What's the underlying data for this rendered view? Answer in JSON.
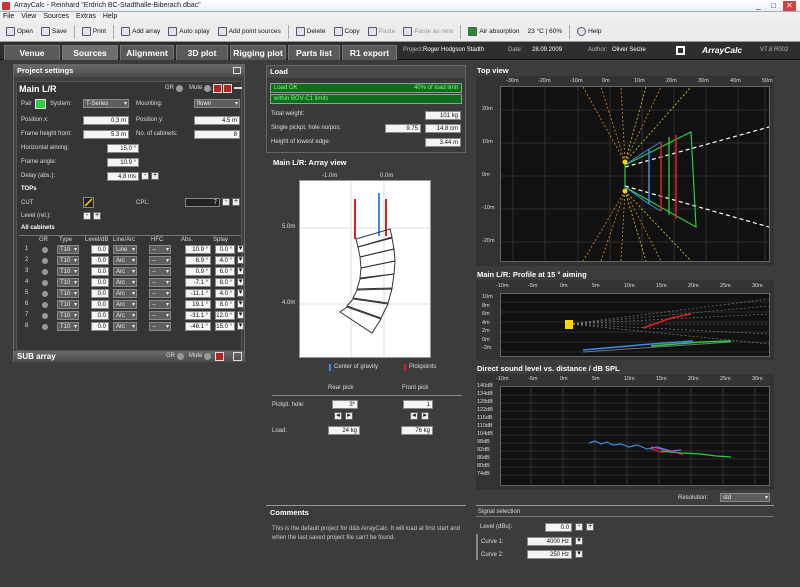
{
  "window": {
    "title": "ArrayCalc - Reinhard \"Erdrich BC-Stadthalle-Biberach.dbac\"",
    "controls": [
      "_",
      "□",
      "✕"
    ]
  },
  "menu": [
    "File",
    "View",
    "Sources",
    "Extras",
    "Help"
  ],
  "toolbar": [
    {
      "label": "Open",
      "enabled": true
    },
    {
      "label": "Save",
      "enabled": true
    },
    {
      "label": "Print",
      "enabled": true
    },
    {
      "label": "Add array",
      "enabled": true
    },
    {
      "label": "Auto splay",
      "enabled": true
    },
    {
      "label": "Add point sources",
      "enabled": true
    },
    {
      "label": "Delete",
      "enabled": true
    },
    {
      "label": "Copy",
      "enabled": true
    },
    {
      "label": "Paste",
      "enabled": false
    },
    {
      "label": "Paste as new",
      "enabled": false
    },
    {
      "label": "Air absorption",
      "enabled": true
    },
    {
      "label": "23 °C | 60%",
      "enabled": true
    },
    {
      "label": "Help",
      "enabled": true
    }
  ],
  "tabs": [
    "Venue",
    "Sources",
    "Alignment",
    "3D plot",
    "Rigging plot",
    "Parts list",
    "R1 export"
  ],
  "active_tab": "Sources",
  "project": {
    "project_label": "Project:",
    "project": "Roger Hodgson Stadth",
    "date_label": "Date:",
    "date": "28.09.2009",
    "author_label": "Author:",
    "author": "Oliver Seizie",
    "brand": "ArrayCalc",
    "version": "V7.8 R002"
  },
  "settings": {
    "title": "Project settings",
    "main_title": "Main L/R",
    "gr": "GR",
    "mute": "Mute",
    "pair_label": "Pair",
    "system_label": "System:",
    "system": "T-Series",
    "mounting_label": "Mounting:",
    "mounting": "flown",
    "position_x_label": "Position x:",
    "position_x": "0.3 m",
    "position_y_label": "Position y:",
    "position_y": "4.5 m",
    "frame_height_label": "Frame height front:",
    "frame_height": "5.3 m",
    "cabinets_label": "No. of cabinets:",
    "cabinets": "8",
    "aiming_label": "Horizontal aiming:",
    "aiming": "15.0 °",
    "frame_angle_label": "Frame angle:",
    "frame_angle": "10.9 °",
    "delay_label": "Delay (abs.):",
    "delay": "4.8 ms",
    "tops_label": "TOPs",
    "cut_label": "CUT",
    "cpl_label": "CPL:",
    "cpl": "7",
    "level_label": "Level (rel.):",
    "all_cabinets": "All cabinets",
    "columns": [
      "GR",
      "Type",
      "Level/dB",
      "Line/Arc",
      "HFC",
      "Abs.",
      "Splay"
    ],
    "rows": [
      {
        "n": "1",
        "type": "T10",
        "level": "0.0",
        "la": "Line",
        "hfc": "--",
        "abs": "10.9 °",
        "splay": "0.0 °"
      },
      {
        "n": "2",
        "type": "T10",
        "level": "0.0",
        "la": "Arc",
        "hfc": "--",
        "abs": "6.9 °",
        "splay": "4.0 °"
      },
      {
        "n": "3",
        "type": "T10",
        "level": "0.0",
        "la": "Arc",
        "hfc": "--",
        "abs": "0.9 °",
        "splay": "6.0 °"
      },
      {
        "n": "4",
        "type": "T10",
        "level": "0.0",
        "la": "Arc",
        "hfc": "--",
        "abs": "-7.1 °",
        "splay": "8.0 °"
      },
      {
        "n": "5",
        "type": "T10",
        "level": "0.0",
        "la": "Arc",
        "hfc": "--",
        "abs": "-11.1 °",
        "splay": "4.0 °"
      },
      {
        "n": "6",
        "type": "T10",
        "level": "0.0",
        "la": "Arc",
        "hfc": "--",
        "abs": "19.1 °",
        "splay": "8.0 °"
      },
      {
        "n": "7",
        "type": "T10",
        "level": "0.0",
        "la": "Arc",
        "hfc": "--",
        "abs": "-31.1 °",
        "splay": "12.0 °"
      },
      {
        "n": "8",
        "type": "T10",
        "level": "0.0",
        "la": "Arc",
        "hfc": "--",
        "abs": "-46.1 °",
        "splay": "15.0 °"
      }
    ],
    "sub_title": "SUB array"
  },
  "load": {
    "title": "Load",
    "status": "Load OK",
    "percent": "40% of load limit",
    "limits": "within BGV-C1 limits",
    "total_weight_label": "Total weight:",
    "total_weight": "101 kg",
    "pickpt_label": "Single pickpt. hole no/pos:",
    "pickpt_no": "9.75",
    "pickpt_pos": "14.8 cm",
    "height_label": "Height of lowest edge:",
    "height": "3.44 m"
  },
  "array_view": {
    "title": "Main L/R: Array view",
    "x_ticks": [
      "-1.0m",
      "0.0m"
    ],
    "y_ticks": [
      "5.0m",
      "4.0m"
    ],
    "legend_cog": "Center of gravity",
    "legend_pick": "Pickpoints",
    "rear_label": "Rear pick",
    "front_label": "Front pick",
    "pickpt_label": "Pickpt. hole:",
    "rear_hole": "3*",
    "front_hole": "1",
    "load_label": "Load:",
    "rear_load": "24 kg",
    "front_load": "76 kg"
  },
  "top_view": {
    "title": "Top view",
    "x_ticks": [
      "-30m",
      "-20m",
      "-10m",
      "0m",
      "10m",
      "20m",
      "30m",
      "40m",
      "50m"
    ],
    "y_ticks": [
      "20m",
      "10m",
      "0m",
      "-10m",
      "-20m"
    ]
  },
  "profile": {
    "title": "Main L/R: Profile at 15 ° aiming",
    "x_ticks": [
      "-10m",
      "-5m",
      "0m",
      "5m",
      "10m",
      "15m",
      "20m",
      "25m",
      "30m"
    ],
    "y_ticks": [
      "10m",
      "8m",
      "6m",
      "4m",
      "2m",
      "0m",
      "-2m"
    ]
  },
  "spl": {
    "title": "Direct sound level vs. distance / dB SPL",
    "x_ticks": [
      "-10m",
      "-5m",
      "0m",
      "5m",
      "10m",
      "15m",
      "20m",
      "25m",
      "30m"
    ],
    "y_ticks": [
      "140dB",
      "134dB",
      "128dB",
      "122dB",
      "116dB",
      "110dB",
      "104dB",
      "98dB",
      "92dB",
      "86dB",
      "80dB",
      "74dB"
    ],
    "resolution_label": "Resolution:",
    "resolution": "std"
  },
  "comments": {
    "title": "Comments",
    "text": "This is the default project for d&b ArrayCalc. It will load at first start and when the last saved project file can't be found."
  },
  "signal": {
    "title": "Signal selection",
    "level_label": "Level (dBu):",
    "level": "0.0",
    "curve1_label": "Curve 1:",
    "curve1": "4000 Hz",
    "curve2_label": "Curve 2:",
    "curve2": "250 Hz"
  },
  "colors": {
    "accent_green": "#2ecc40",
    "ok_green": "#0b6e1a",
    "cog_blue": "#3a8ee6",
    "pick_red": "#e02020"
  }
}
